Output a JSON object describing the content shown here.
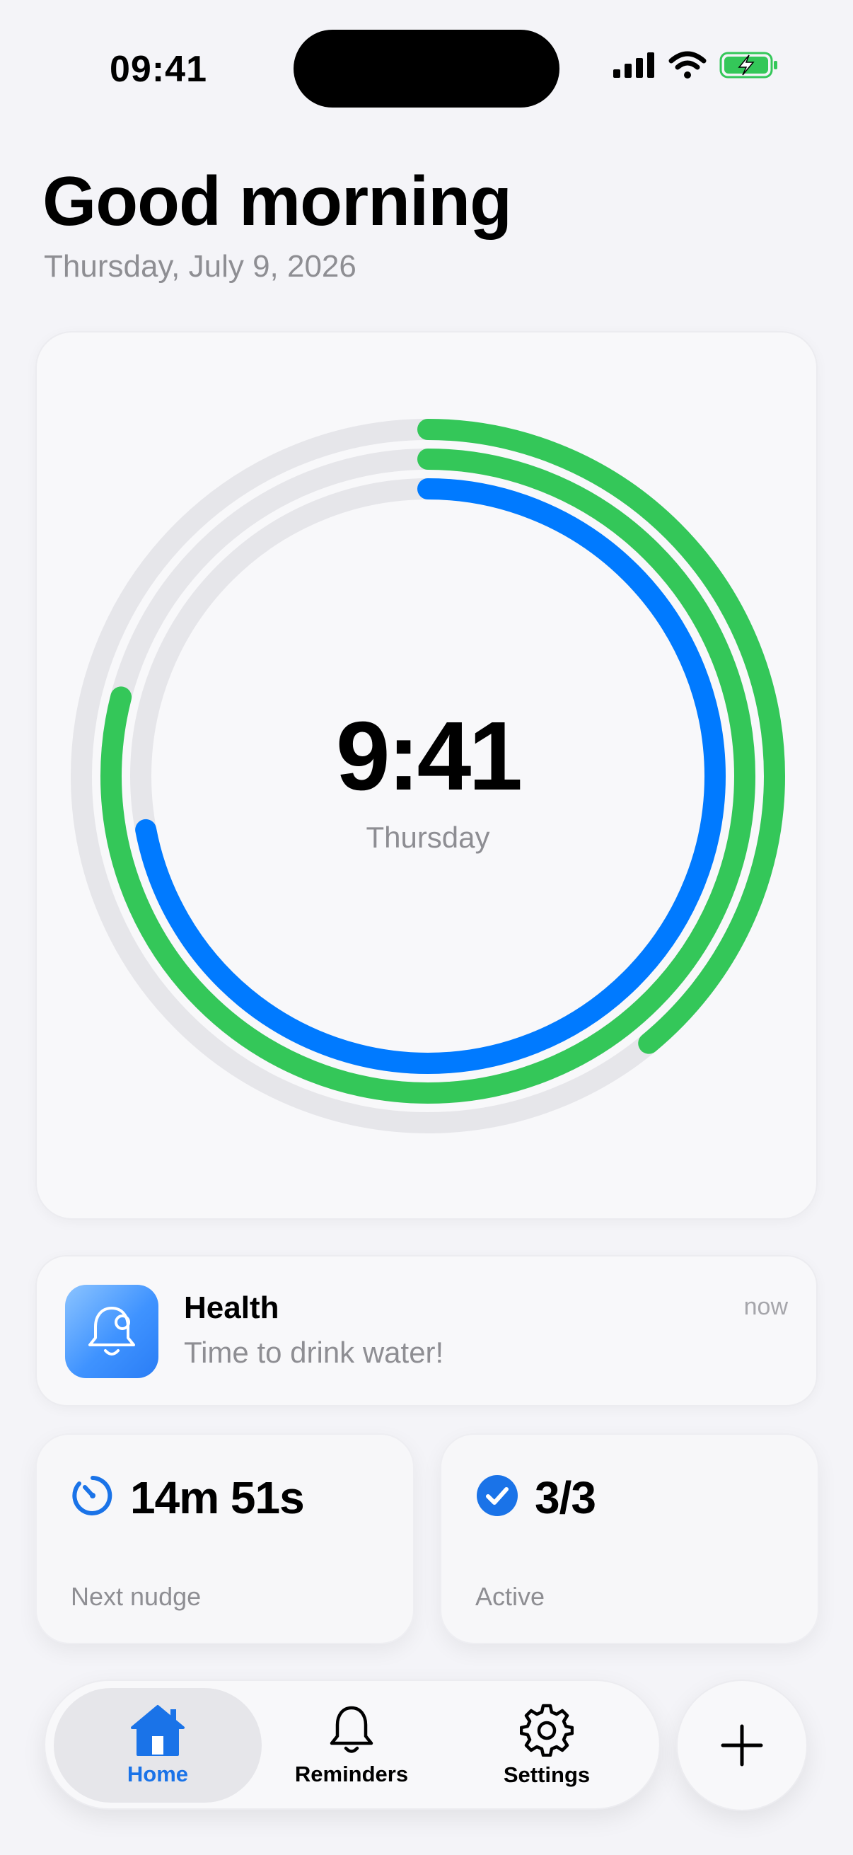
{
  "status_bar": {
    "time": "09:41"
  },
  "header": {
    "greeting": "Good morning",
    "date": "Thursday, July 9, 2026"
  },
  "ring": {
    "time": "9:41",
    "day": "Thursday",
    "progress": {
      "outer": 0.39,
      "middle": 0.79,
      "inner": 0.72
    },
    "colors": {
      "green": "#34c759",
      "blue": "#007aff",
      "track": "#e6e6ea"
    }
  },
  "notification": {
    "icon": "bell-icon",
    "title": "Health",
    "body": "Time to drink water!",
    "time": "now"
  },
  "stats": [
    {
      "icon": "timer-icon",
      "value": "14m 51s",
      "label": "Next nudge"
    },
    {
      "icon": "checkmark-circle-icon",
      "value": "3/3",
      "label": "Active"
    }
  ],
  "tabbar": {
    "tabs": [
      {
        "icon": "house-icon",
        "label": "Home",
        "selected": true
      },
      {
        "icon": "bell-icon",
        "label": "Reminders",
        "selected": false
      },
      {
        "icon": "gear-icon",
        "label": "Settings",
        "selected": false
      }
    ],
    "add_icon": "plus-icon"
  },
  "accent": "#1a73e8"
}
